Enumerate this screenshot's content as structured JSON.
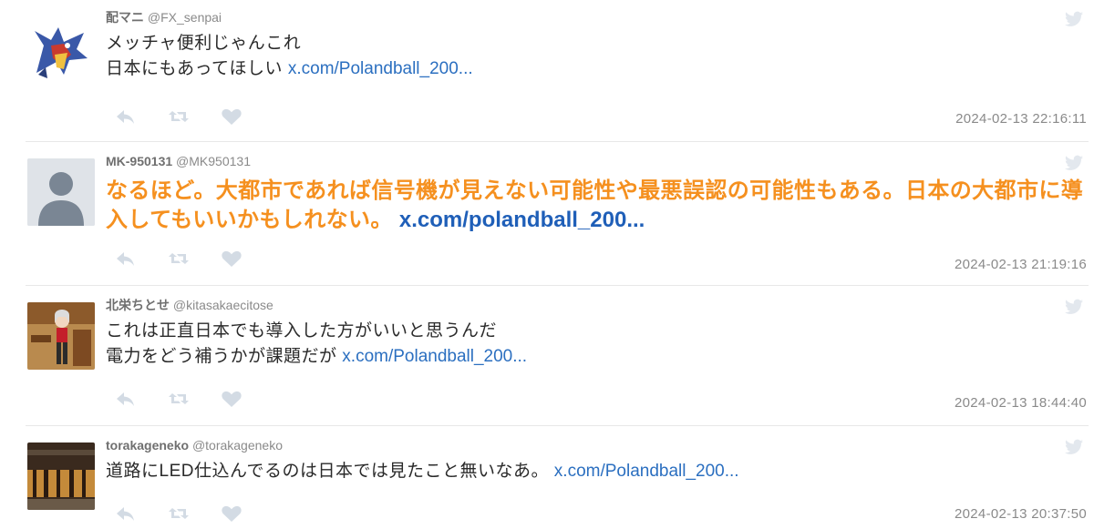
{
  "tweets": [
    {
      "name": "配マニ",
      "handle": "@FX_senpai",
      "line1": "メッチャ便利じゃんこれ",
      "line2": "日本にもあってほしい",
      "link": "x.com/Polandball_200...",
      "timestamp": "2024-02-13 22:16:11",
      "avatar": "dragon-avatar"
    },
    {
      "name": "MK-950131",
      "handle": "@MK950131",
      "text": "なるほど。大都市であれば信号機が見えない可能性や最悪誤認の可能性もある。日本の大都市に導入してもいいかもしれない。",
      "link": "x.com/polandball_200...",
      "timestamp": "2024-02-13 21:19:16",
      "avatar": "default-avatar",
      "highlighted": true
    },
    {
      "name": "北栄ちとせ",
      "handle": "@kitasakaecitose",
      "line1": "これは正直日本でも導入した方がいいと思うんだ",
      "line2": "電力をどう補うかが課題だが",
      "link": "x.com/Polandball_200...",
      "timestamp": "2024-02-13 18:44:40",
      "avatar": "anime-character-avatar"
    },
    {
      "name": "torakageneko",
      "handle": "@torakageneko",
      "line1": "道路にLED仕込んでるのは日本では見たこと無いなあ。",
      "link": "x.com/Polandball_200...",
      "timestamp": "2024-02-13 20:37:50",
      "avatar": "tiger-avatar"
    }
  ],
  "colors": {
    "link": "#2b6fc0",
    "highlight_text": "#f5901f",
    "action_icon": "#d5dde6",
    "meta": "#7b7b7b"
  },
  "icons": [
    "reply-icon",
    "retweet-icon",
    "like-icon",
    "twitter-bird-icon"
  ]
}
